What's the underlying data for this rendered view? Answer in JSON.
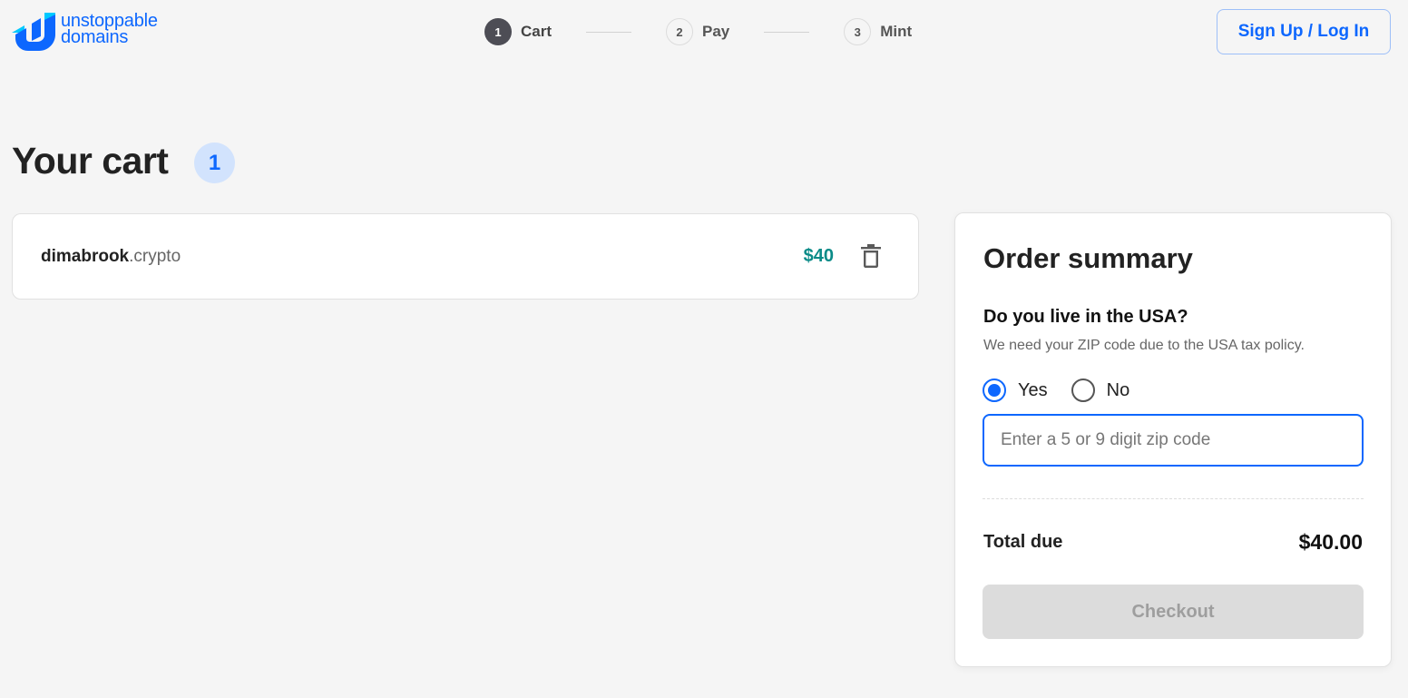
{
  "brand": {
    "name_line1": "unstoppable",
    "name_line2": "domains",
    "color": "#0d67fe",
    "logo_icon": "unstoppable-logo-icon"
  },
  "stepper": {
    "steps": [
      {
        "num": "1",
        "label": "Cart",
        "active": true
      },
      {
        "num": "2",
        "label": "Pay",
        "active": false
      },
      {
        "num": "3",
        "label": "Mint",
        "active": false
      }
    ]
  },
  "header": {
    "login_label": "Sign Up / Log In"
  },
  "cart": {
    "title": "Your cart",
    "count": "1",
    "items": [
      {
        "domain_label": "dimabrook",
        "domain_tld": ".crypto",
        "price": "$40",
        "delete_icon": "trash-icon"
      }
    ]
  },
  "summary": {
    "title": "Order summary",
    "usa_question": "Do you live in the USA?",
    "usa_note": "We need your ZIP code due to the USA tax policy.",
    "options": [
      {
        "label": "Yes",
        "checked": true
      },
      {
        "label": "No",
        "checked": false
      }
    ],
    "zip_placeholder": "Enter a 5 or 9 digit zip code",
    "zip_value": "",
    "total_label": "Total due",
    "total_value": "$40.00",
    "checkout_label": "Checkout"
  },
  "colors": {
    "accent": "#0d67fe",
    "price": "#0b8b88",
    "background": "#f5f5f5",
    "disabled_button": "#dcdcdc"
  }
}
